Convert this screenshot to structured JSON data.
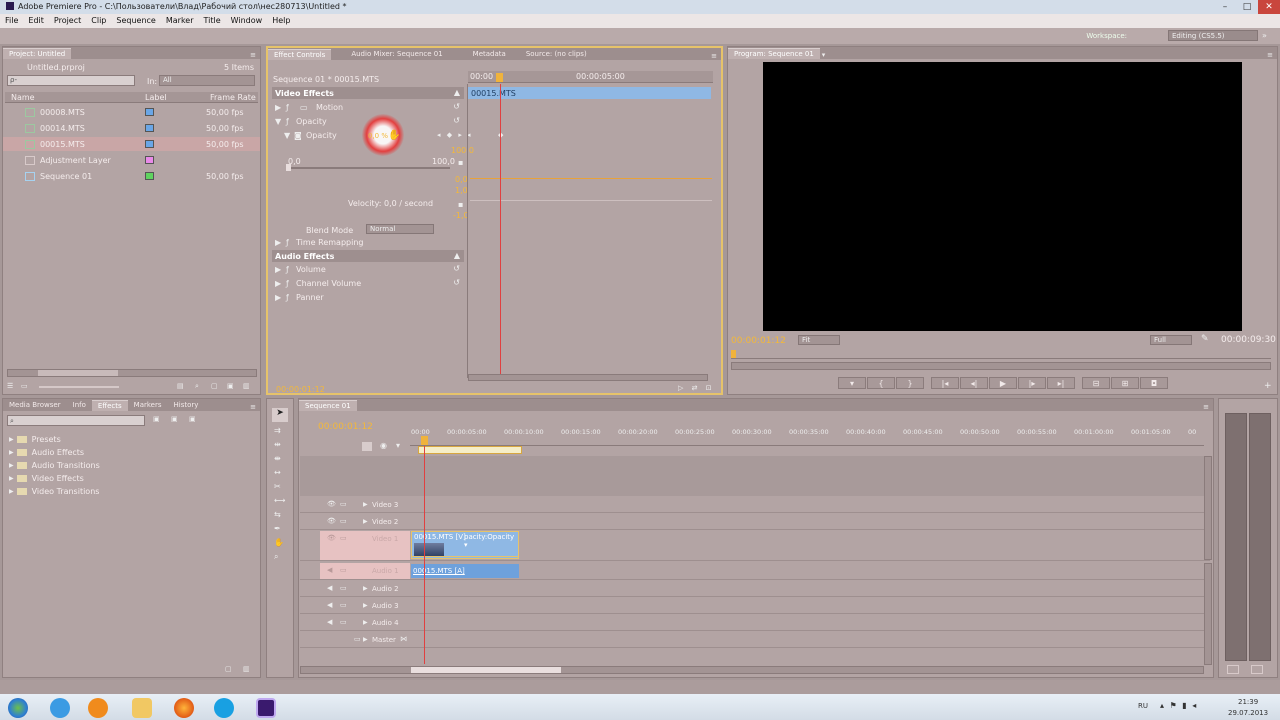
{
  "window": {
    "title": "Adobe Premiere Pro - C:\\Пользователи\\Влад\\Рабочий стол\\нес280713\\Untitled *",
    "minimize": "–",
    "maximize": "□",
    "close": "✕"
  },
  "menu": [
    "File",
    "Edit",
    "Project",
    "Clip",
    "Sequence",
    "Marker",
    "Title",
    "Window",
    "Help"
  ],
  "workspace": {
    "label": "Workspace:",
    "value": "Editing (CS5.5)"
  },
  "project_panel": {
    "tab": "Project: Untitled",
    "file": "Untitled.prproj",
    "count": "5 Items",
    "search_placeholder": "ρ-",
    "in_label": "In:",
    "in_value": "All",
    "columns": {
      "name": "Name",
      "label": "Label",
      "rate": "Frame Rate"
    },
    "items": [
      {
        "name": "00008.MTS",
        "rate": "50,00 fps",
        "color": "#6aa6e6"
      },
      {
        "name": "00014.MTS",
        "rate": "50,00 fps",
        "color": "#6aa6e6"
      },
      {
        "name": "00015.MTS",
        "rate": "50,00 fps",
        "color": "#6aa6e6"
      },
      {
        "name": "Adjustment Layer",
        "rate": "",
        "color": "#e98ae8"
      },
      {
        "name": "Sequence 01",
        "rate": "50,00 fps",
        "color": "#5fd35f"
      }
    ]
  },
  "effect_controls": {
    "tabs": [
      "Effect Controls",
      "Audio Mixer: Sequence 01",
      "Metadata",
      "Source: (no clips)"
    ],
    "sequence_path": "Sequence 01 * 00015.MTS",
    "ruler_start": "00:00",
    "ruler_mid": "00:00:05:00",
    "clip_label": "00015.MTS",
    "video_effects": "Video Effects",
    "motion": "Motion",
    "opacity": "Opacity",
    "opacity_prop": "Opacity",
    "opacity_value": "0,0 %",
    "range_min": "0,0",
    "range_max": "100,0",
    "graph_values": [
      "100,0",
      "0,0",
      "1,0",
      "-1,0"
    ],
    "velocity": "Velocity: 0,0 / second",
    "blend_mode_label": "Blend Mode",
    "blend_mode_value": "Normal",
    "time_remapping": "Time Remapping",
    "audio_effects": "Audio Effects",
    "volume": "Volume",
    "channel_volume": "Channel Volume",
    "panner": "Panner",
    "timecode": "00:00:01:12"
  },
  "program_monitor": {
    "tab": "Program: Sequence 01",
    "timecode": "00:00:01:12",
    "fit": "Fit",
    "resolution": "Full",
    "duration": "00:00:09:30"
  },
  "effects_panel": {
    "tabs": [
      "Media Browser",
      "Info",
      "Effects",
      "Markers",
      "History"
    ],
    "folders": [
      "Presets",
      "Audio Effects",
      "Audio Transitions",
      "Video Effects",
      "Video Transitions"
    ]
  },
  "timeline": {
    "tab": "Sequence 01",
    "timecode": "00:00:01:12",
    "ruler": [
      "00:00",
      "00:00:05:00",
      "00:00:10:00",
      "00:00:15:00",
      "00:00:20:00",
      "00:00:25:00",
      "00:00:30:00",
      "00:00:35:00",
      "00:00:40:00",
      "00:00:45:00",
      "00:00:50:00",
      "00:00:55:00",
      "00:01:00:00",
      "00:01:05:00",
      "00"
    ],
    "tracks": {
      "video3": "Video 3",
      "video2": "Video 2",
      "video1": "Video 1",
      "audio1": "Audio 1",
      "audio2": "Audio 2",
      "audio3": "Audio 3",
      "audio4": "Audio 4",
      "master": "Master"
    },
    "video_clip": "00015.MTS [V]",
    "video_clip_fx": "pacity:Opacity ▾",
    "audio_clip": "00015.MTS [A]"
  },
  "taskbar": {
    "lang": "RU",
    "time": "21:39",
    "date": "29.07.2013"
  }
}
